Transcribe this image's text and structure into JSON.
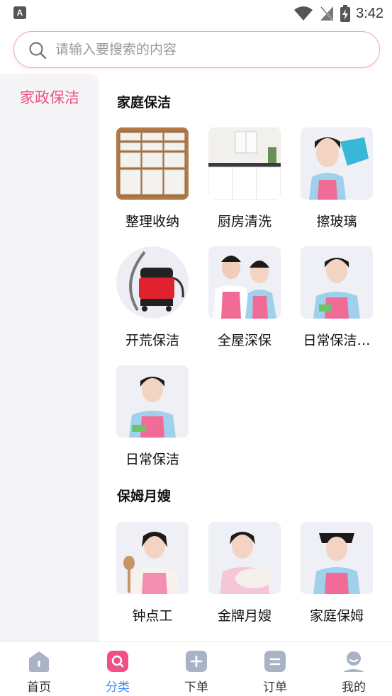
{
  "status_bar": {
    "app_badge": "A",
    "time": "3:42"
  },
  "search": {
    "placeholder": "请输入要搜索的内容"
  },
  "sidebar": {
    "items": [
      {
        "label": "家政保洁",
        "selected": true
      }
    ]
  },
  "sections": [
    {
      "title": "家庭保洁",
      "items": [
        {
          "label": "整理收纳",
          "icon": "storage-drawers"
        },
        {
          "label": "厨房清洗",
          "icon": "kitchen"
        },
        {
          "label": "擦玻璃",
          "icon": "cleaner-with-cloth"
        },
        {
          "label": "开荒保洁",
          "icon": "vacuum-cleaner"
        },
        {
          "label": "全屋深保",
          "icon": "cleaner-couple"
        },
        {
          "label": "日常保洁…",
          "icon": "cleaner-woman"
        },
        {
          "label": "日常保洁",
          "icon": "cleaner-woman"
        }
      ]
    },
    {
      "title": "保姆月嫂",
      "items": [
        {
          "label": "钟点工",
          "icon": "housekeeper-woman"
        },
        {
          "label": "金牌月嫂",
          "icon": "nanny-with-baby"
        },
        {
          "label": "家庭保姆",
          "icon": "housekeeper-with-cap"
        }
      ]
    }
  ],
  "tabs": [
    {
      "label": "首页",
      "icon": "home-icon",
      "active": false
    },
    {
      "label": "分类",
      "icon": "category-search-icon",
      "active": true
    },
    {
      "label": "下单",
      "icon": "plus-icon",
      "active": false
    },
    {
      "label": "订单",
      "icon": "order-list-icon",
      "active": false
    },
    {
      "label": "我的",
      "icon": "profile-icon",
      "active": false
    }
  ],
  "colors": {
    "accent_pink": "#f05086",
    "active_tab_blue": "#4a8ef0",
    "tab_icon_gray": "#a9b3c6"
  }
}
